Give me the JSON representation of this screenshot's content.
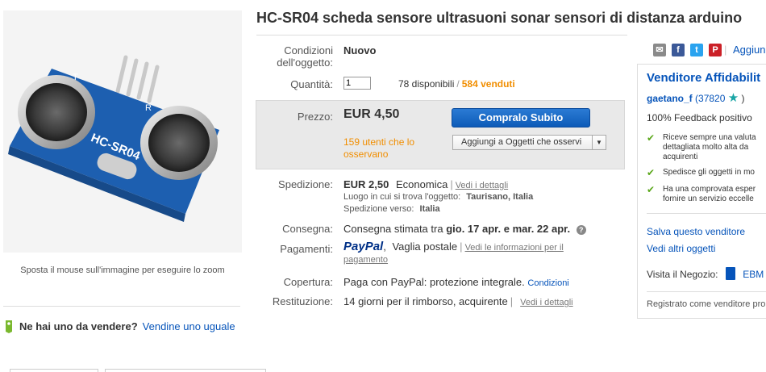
{
  "product": {
    "title": "HC-SR04 scheda sensore ultrasuoni sonar sensori di distanza arduino",
    "image_board_text": "HC-SR04",
    "image_label_t": "T",
    "image_label_r": "R",
    "zoom_hint": "Sposta il mouse sull'immagine per eseguire lo zoom"
  },
  "sell": {
    "question": "Ne hai uno da vendere?",
    "link": "Vendine uno uguale"
  },
  "details": {
    "condition_label": "Condizioni dell'oggetto:",
    "condition_value": "Nuovo",
    "quantity_label": "Quantità:",
    "quantity_value": "1",
    "available": "78 disponibili",
    "sold": "584 venduti",
    "price_label": "Prezzo:",
    "price_value": "EUR 4,50",
    "watchers": "159 utenti che lo osservano",
    "buy_button": "Compralo Subito",
    "watch_button": "Aggiungi a Oggetti che osservi",
    "shipping_label": "Spedizione:",
    "shipping_cost": "EUR 2,50",
    "shipping_type": "Economica",
    "shipping_details_link": "Vedi i dettagli",
    "location_label": "Luogo in cui si trova l'oggetto:",
    "location_value": "Taurisano, Italia",
    "ship_to_label": "Spedizione verso:",
    "ship_to_value": "Italia",
    "delivery_label": "Consegna:",
    "delivery_text": "Consegna stimata tra",
    "delivery_dates": "gio. 17 apr. e mar. 22 apr.",
    "payment_label": "Pagamenti:",
    "paypal": "PayPal",
    "payment_other": "Vaglia postale",
    "payment_link": "Vedi le informazioni per il pagamento",
    "coverage_label": "Copertura:",
    "coverage_text": "Paga con PayPal: protezione integrale.",
    "coverage_link": "Condizioni",
    "returns_label": "Restituzione:",
    "returns_text": "14 giorni per il rimborso, acquirente",
    "returns_link": "Vedi i dettagli"
  },
  "share": {
    "more_link": "Aggiun"
  },
  "seller": {
    "title": "Venditore Affidabilit",
    "name": "gaetano_f",
    "score": "(37820",
    "score_close": ")",
    "feedback": "100% Feedback positivo",
    "points": [
      [
        "Riceve sempre una valuta",
        "dettagliata molto alta da",
        "acquirenti"
      ],
      [
        "Spedisce gli oggetti in mo"
      ],
      [
        "Ha una comprovata esper",
        "fornire un servizio eccelle"
      ]
    ],
    "save_link": "Salva questo venditore",
    "other_items_link": "Vedi altri oggetti",
    "store_label": "Visita il Negozio:",
    "store_name": "EBM",
    "registered": "Registrato come venditore pro"
  },
  "colors": {
    "link": "#0654ba",
    "orange": "#f18e00",
    "buy_button": "#0d5bb8",
    "price_box": "#e9e9e9",
    "check": "#5ba71b"
  }
}
